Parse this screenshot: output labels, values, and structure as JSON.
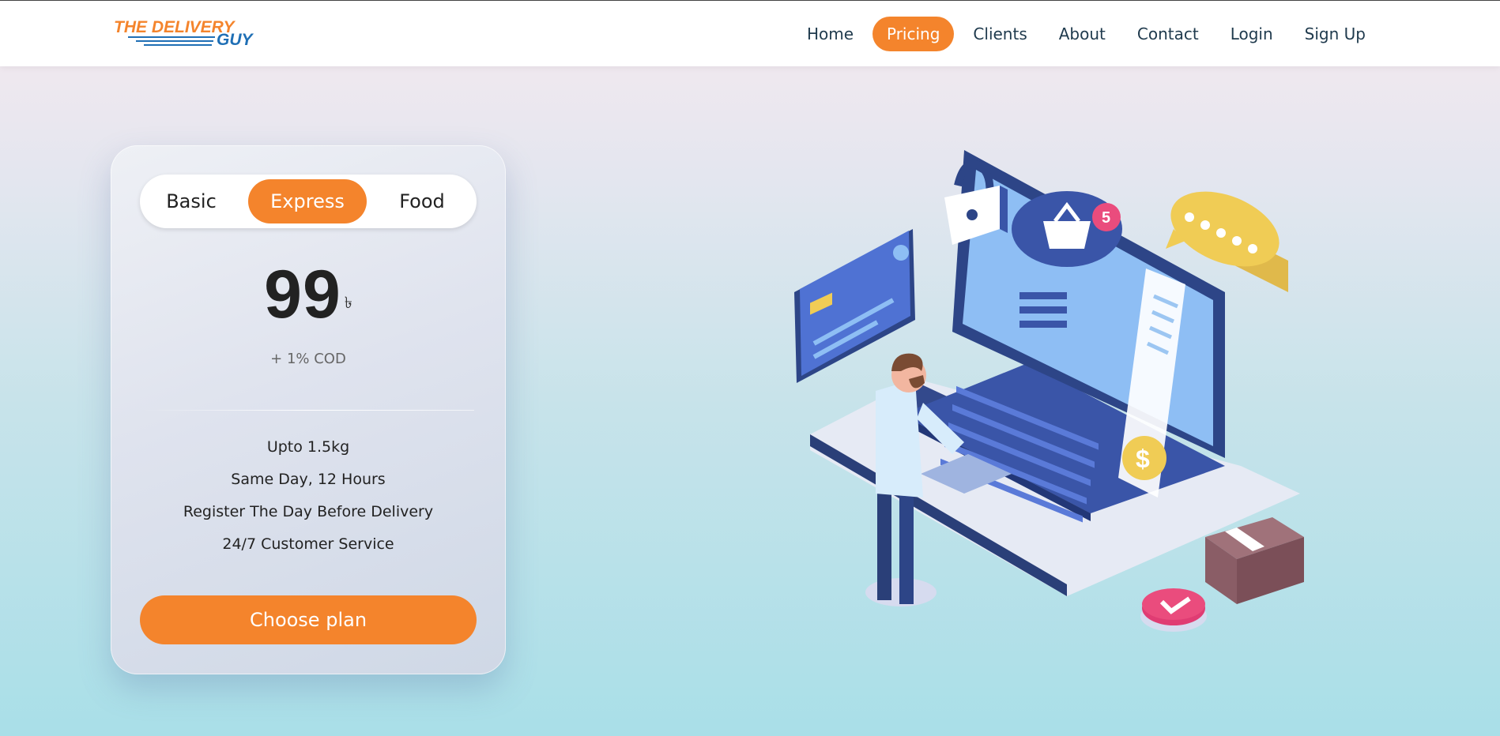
{
  "brand": {
    "logo_line1": "THE DELIVERY",
    "logo_line2": "GUY"
  },
  "nav": {
    "items": [
      {
        "label": "Home"
      },
      {
        "label": "Pricing"
      },
      {
        "label": "Clients"
      },
      {
        "label": "About"
      },
      {
        "label": "Contact"
      },
      {
        "label": "Login"
      },
      {
        "label": "Sign Up"
      }
    ],
    "active": "Pricing"
  },
  "pricing": {
    "tabs": [
      {
        "label": "Basic"
      },
      {
        "label": "Express"
      },
      {
        "label": "Food"
      }
    ],
    "selected_tab": "Express",
    "price": "99",
    "currency": "৳",
    "cod_note": "+ 1% COD",
    "features": [
      "Upto 1.5kg",
      "Same Day, 12 Hours",
      "Register The Day Before Delivery",
      "24/7 Customer Service"
    ],
    "cta_label": "Choose plan"
  },
  "colors": {
    "accent": "#f4842c",
    "nav_text": "#1f3a4d"
  },
  "illustration": {
    "icon": "online-shopping-illustration",
    "basket_badge": "5",
    "coin_symbol": "$"
  }
}
